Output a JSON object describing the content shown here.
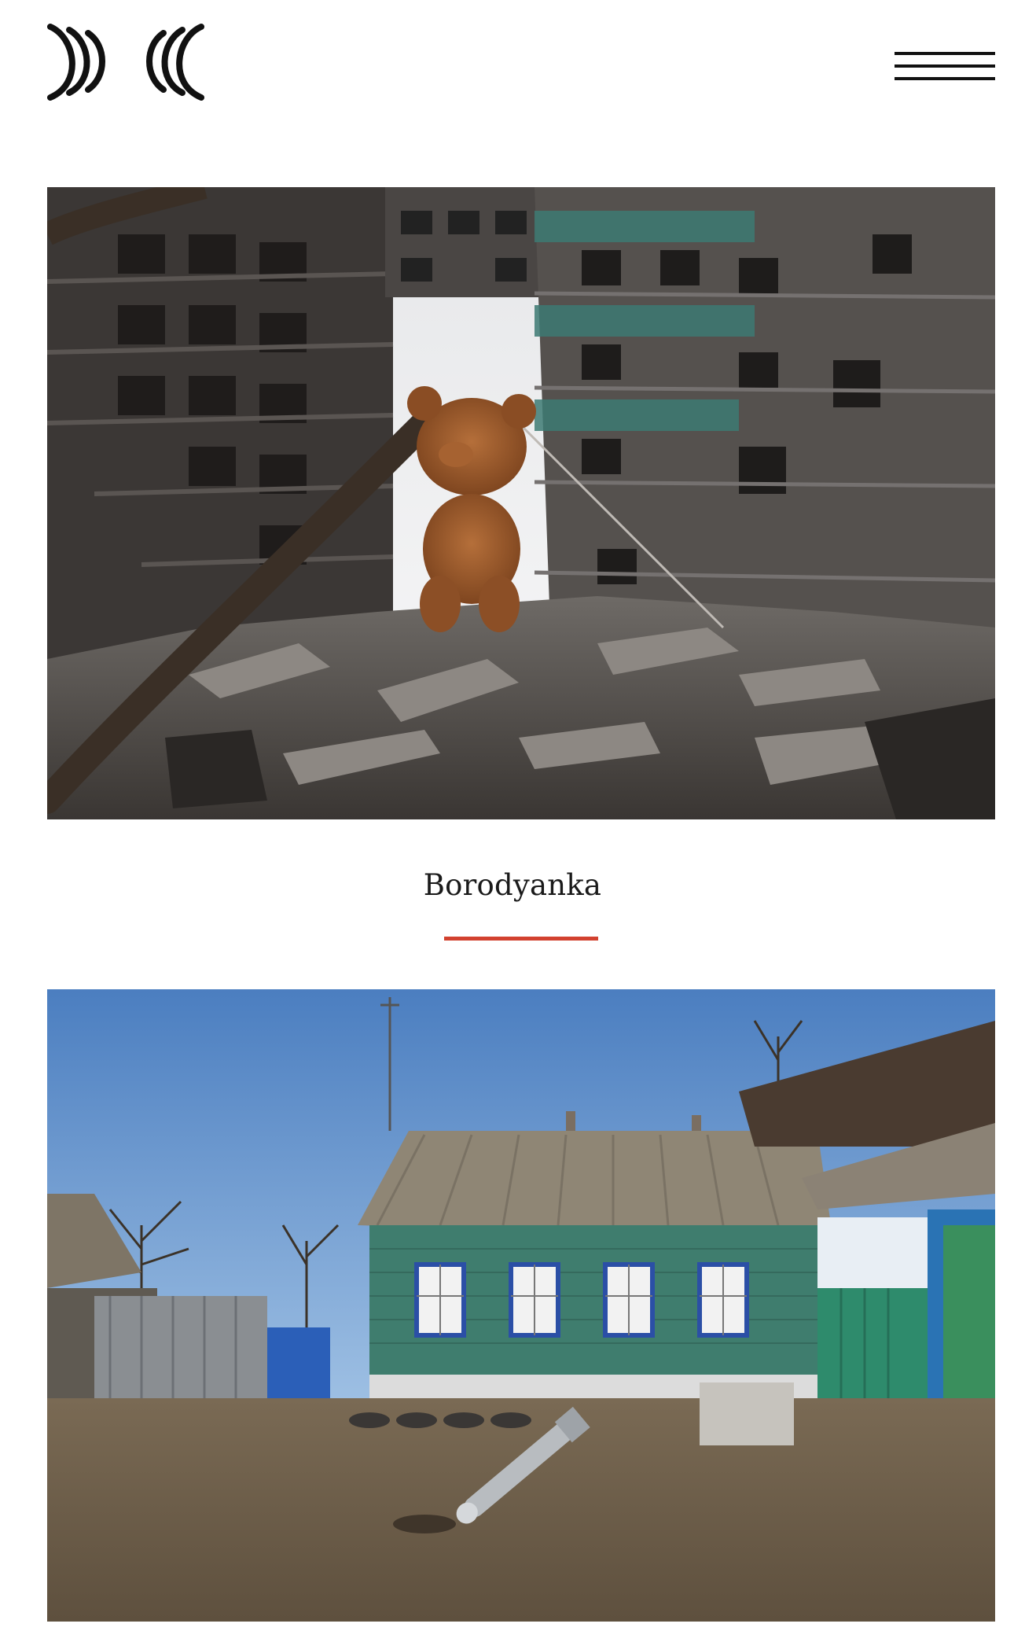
{
  "header": {
    "logo_icon": "brand-logo-icon",
    "menu_icon": "hamburger-menu-icon"
  },
  "gallery": {
    "items": [
      {
        "caption": "Borodyanka",
        "accent_color": "#d2412f"
      },
      {
        "caption": ""
      }
    ]
  },
  "colors": {
    "background": "#ffffff",
    "text": "#1a1a1a",
    "accent": "#d2412f"
  }
}
